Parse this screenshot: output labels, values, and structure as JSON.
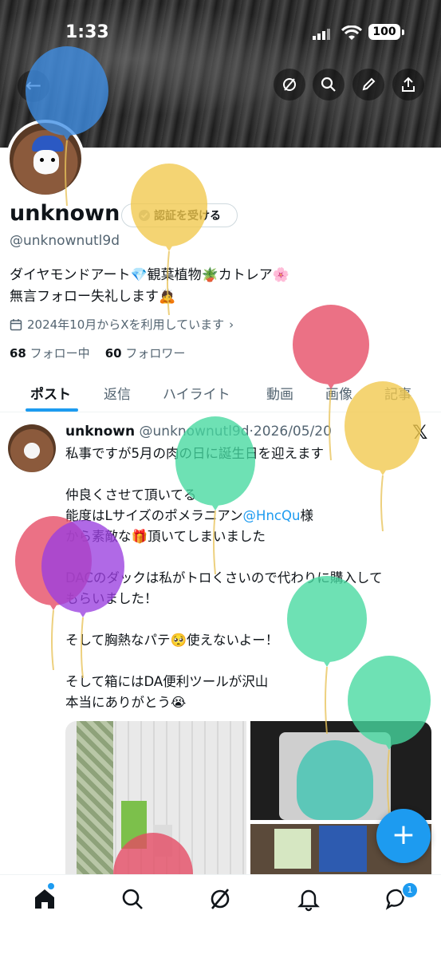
{
  "status_bar": {
    "time": "1:33",
    "battery": "100"
  },
  "profile": {
    "display_name": "unknown",
    "verify_label": "認証を受ける",
    "handle": "@unknownutl9d",
    "bio_line1": "ダイヤモンドアート💎観葉植物🪴カトレア🌸",
    "bio_line2": "無言フォロー失礼します🙇",
    "joined": "2024年10月からXを利用しています",
    "following_count": "68",
    "following_label": "フォロー中",
    "followers_count": "60",
    "followers_label": "フォロワー"
  },
  "tabs": [
    "ポスト",
    "返信",
    "ハイライト",
    "動画",
    "画像",
    "記事"
  ],
  "post": {
    "author_name": "unknown",
    "author_meta": "@unknownutl9d·2026/05/20",
    "text_a": "私事ですが5月の肉の日に誕生日を迎えます\n\n仲良くさせて頂いてる\n能度はLサイズのポメラニアン",
    "mention": "@HncQu",
    "text_b": "様\nから素敵な🎁頂いてしまいました\n\nDACのダックは私がトロくさいので代わりに購入して\nもらいました！\n\nそして胸熱なパテ🥺使えないよー！\n\nそして箱にはDA便利ツールが沢山\n本当にありがとう😭"
  },
  "fab_label": "+",
  "nav": {
    "messages_badge": "1"
  },
  "colors": {
    "accent": "#1d9bf0",
    "text": "#0f1419",
    "secondary": "#536471"
  },
  "balloons": [
    {
      "name": "balloon-blue",
      "color": "#3f8fe6"
    },
    {
      "name": "balloon-yellow-1",
      "color": "#f2c94c"
    },
    {
      "name": "balloon-red-1",
      "color": "#e64a63"
    },
    {
      "name": "balloon-yellow-2",
      "color": "#f2c94c"
    },
    {
      "name": "balloon-green-1",
      "color": "#46d9a0"
    },
    {
      "name": "balloon-red-2",
      "color": "#e64a63"
    },
    {
      "name": "balloon-purple",
      "color": "#9b3fe0"
    },
    {
      "name": "balloon-green-2",
      "color": "#46d9a0"
    },
    {
      "name": "balloon-green-3",
      "color": "#46d9a0"
    },
    {
      "name": "balloon-pink",
      "color": "#e64a63"
    }
  ]
}
